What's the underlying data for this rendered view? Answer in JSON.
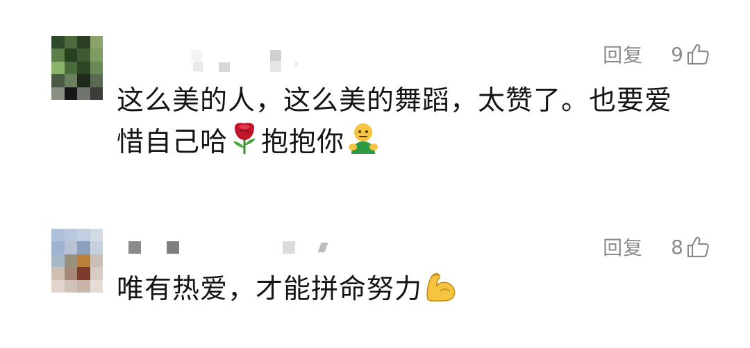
{
  "comments": [
    {
      "reply_label": "回复",
      "like_count": "9",
      "text_line1": "这么美的人，这么美的舞蹈，太赞了。也要爱",
      "text_line2_a": "惜自己哈",
      "text_line2_b": "抱抱你",
      "emojis": [
        "rose-icon",
        "hugging-person-icon"
      ]
    },
    {
      "reply_label": "回复",
      "like_count": "8",
      "text": "唯有热爱，才能拼命努力",
      "emojis": [
        "flexed-biceps-icon"
      ]
    }
  ],
  "colors": {
    "meta_gray": "#8a8a8a",
    "text": "#141414",
    "background": "#ffffff"
  }
}
